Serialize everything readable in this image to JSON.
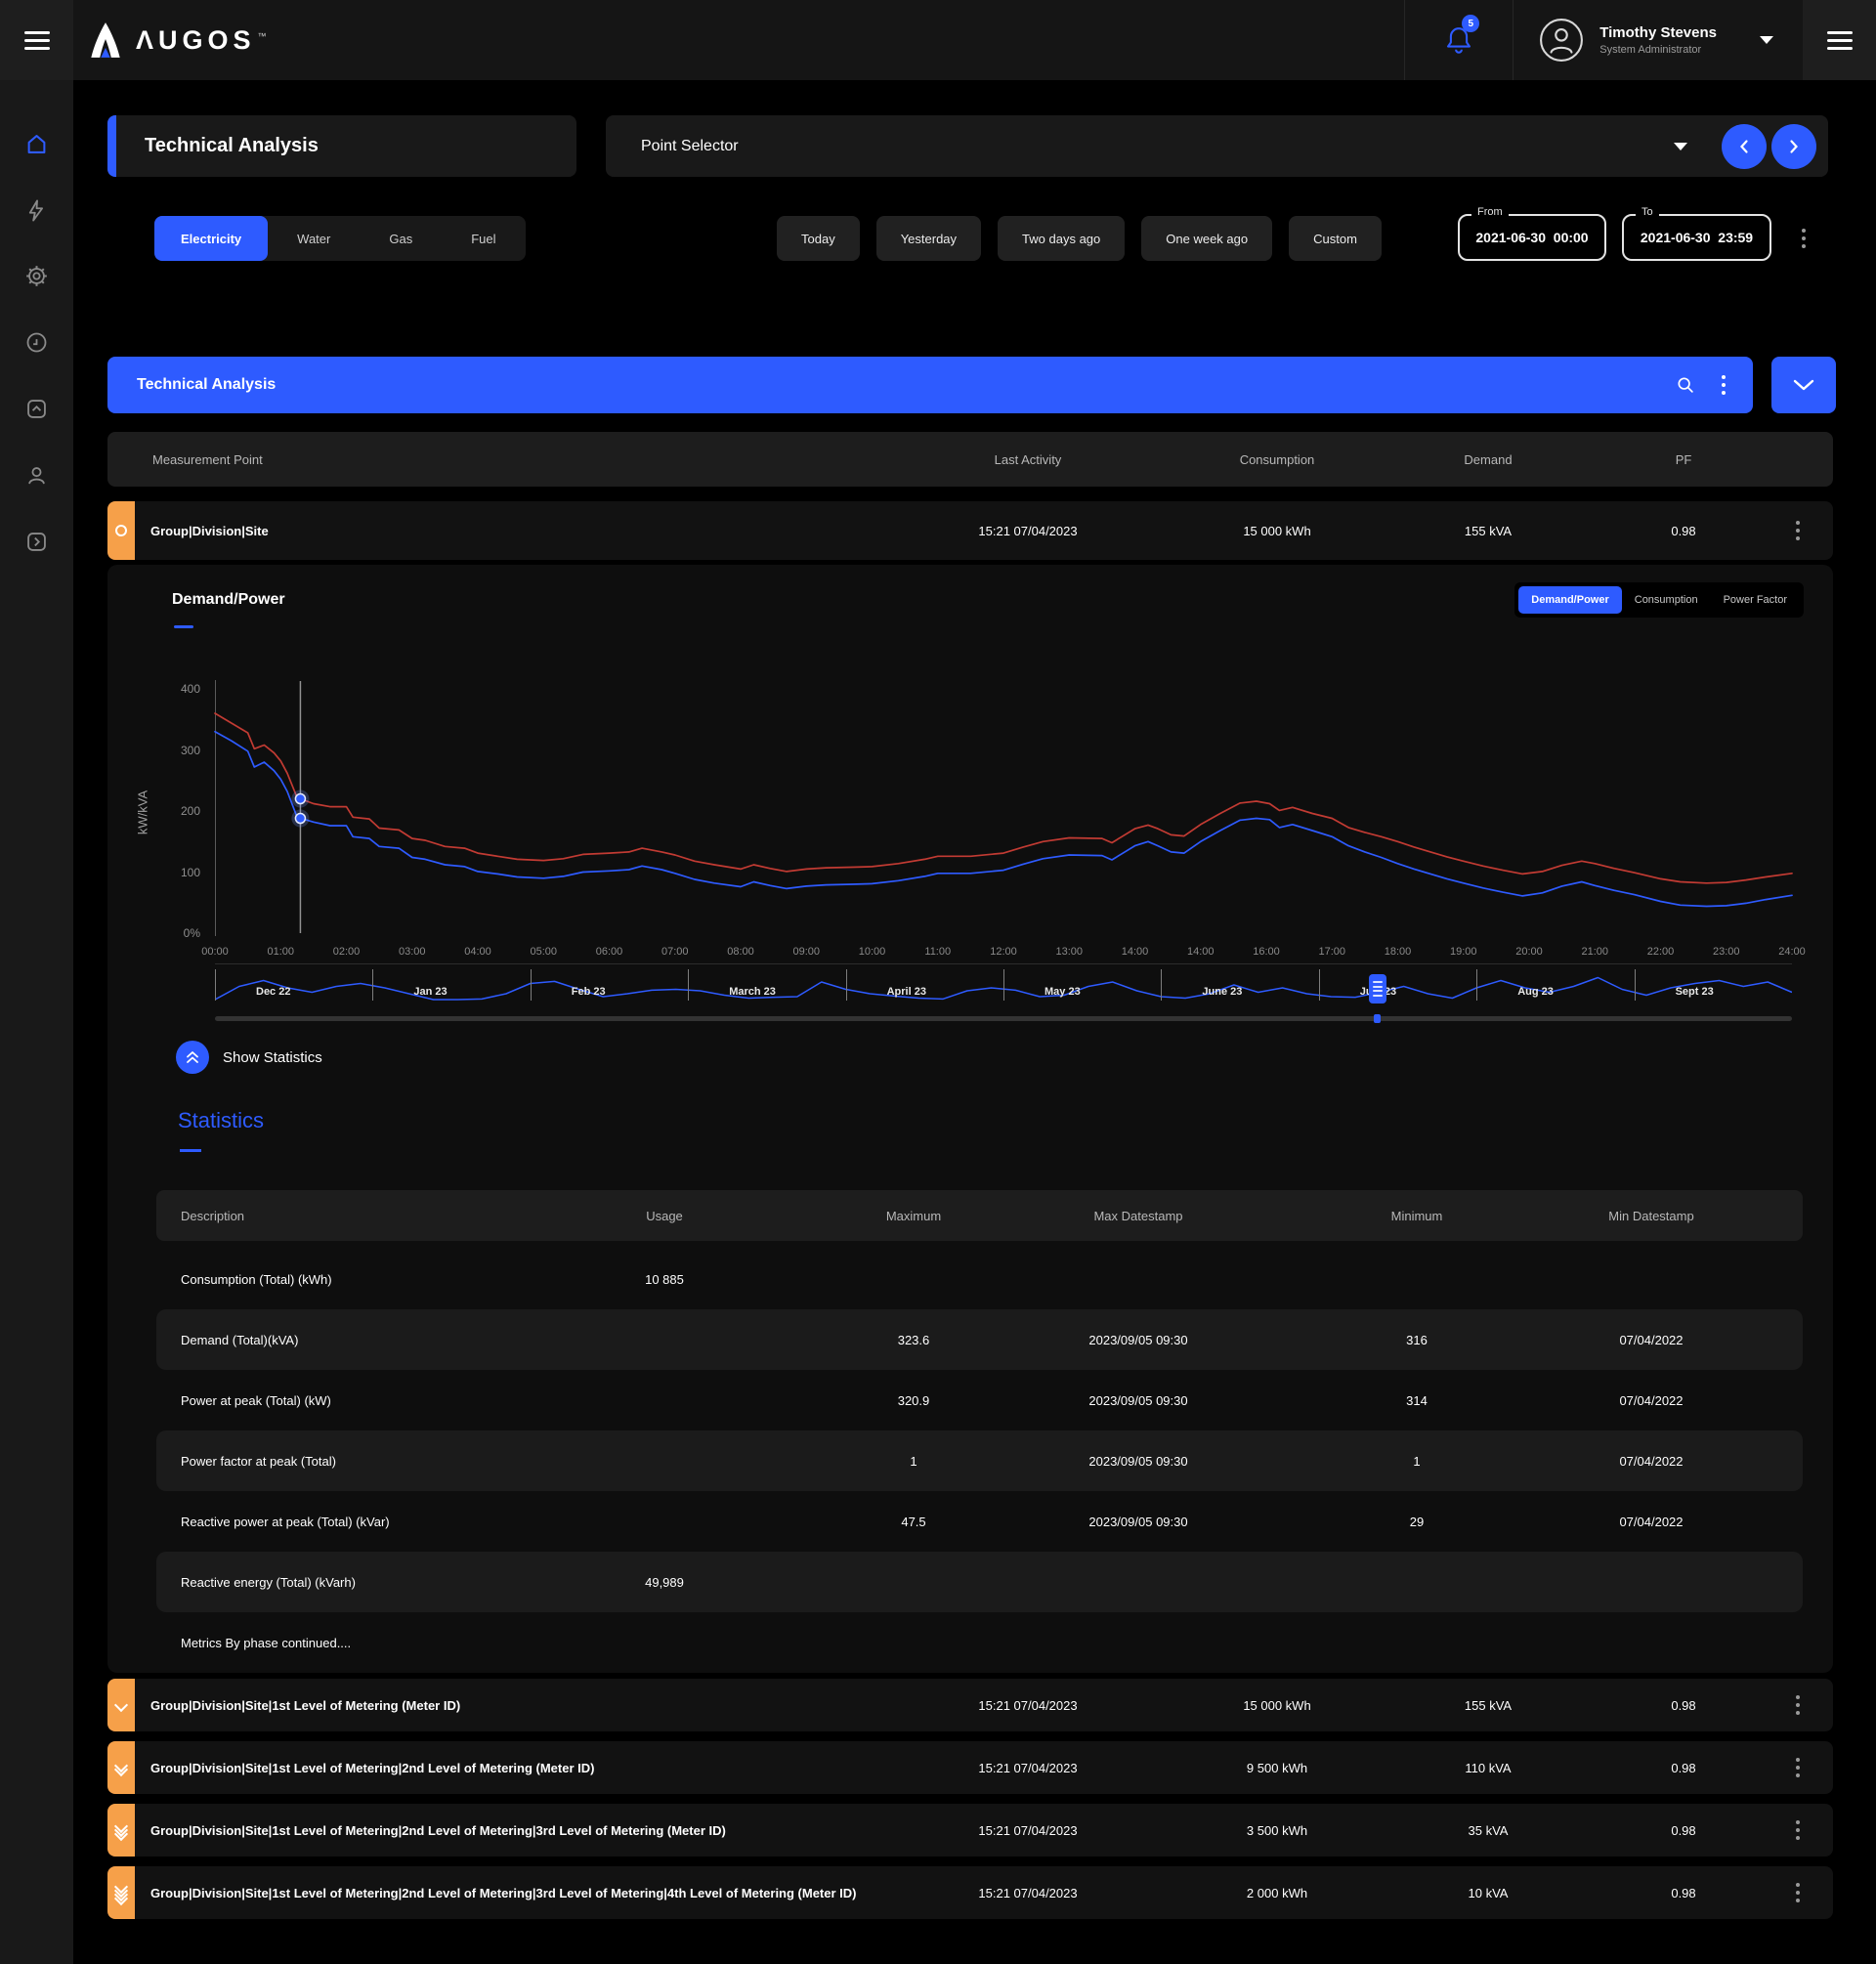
{
  "accent_blue": "#2E5BFF",
  "accent_orange": "#F6A049",
  "topbar": {
    "brand": "ΛUGOS",
    "brand_tm": "™",
    "notification_count": "5",
    "user_name": "Timothy Stevens",
    "user_role": "System Administrator"
  },
  "page": {
    "title": "Technical Analysis",
    "point_selector": "Point Selector"
  },
  "tabs": [
    {
      "label": "Electricity",
      "active": true
    },
    {
      "label": "Water",
      "active": false
    },
    {
      "label": "Gas",
      "active": false
    },
    {
      "label": "Fuel",
      "active": false
    }
  ],
  "time_filters": {
    "buttons": [
      "Today",
      "Yesterday",
      "Two days ago",
      "One week ago",
      "Custom"
    ],
    "from": {
      "label": "From",
      "value": "2021-06-30  00:00"
    },
    "to": {
      "label": "To",
      "value": "2021-06-30  23:59"
    }
  },
  "section_bar": {
    "title": "Technical Analysis"
  },
  "measurements": {
    "headers": [
      "Measurement Point",
      "Last Activity",
      "Consumption",
      "Demand",
      "PF"
    ],
    "main_row": {
      "name": "Group|Division|Site",
      "last_activity": "15:21 07/04/2023",
      "consumption": "15 000 kWh",
      "demand": "155 kVA",
      "pf": "0.98"
    },
    "child_rows": [
      {
        "level": 1,
        "name": "Group|Division|Site|1st Level of Metering (Meter ID)",
        "last_activity": "15:21 07/04/2023",
        "consumption": "15 000 kWh",
        "demand": "155 kVA",
        "pf": "0.98"
      },
      {
        "level": 2,
        "name": "Group|Division|Site|1st Level of Metering|2nd Level of Metering (Meter ID)",
        "last_activity": "15:21 07/04/2023",
        "consumption": "9 500 kWh",
        "demand": "110 kVA",
        "pf": "0.98"
      },
      {
        "level": 3,
        "name": "Group|Division|Site|1st Level of Metering|2nd Level of Metering|3rd Level of Metering (Meter ID)",
        "last_activity": "15:21 07/04/2023",
        "consumption": "3 500 kWh",
        "demand": "35 kVA",
        "pf": "0.98"
      },
      {
        "level": 4,
        "name": "Group|Division|Site|1st Level of Metering|2nd Level of Metering|3rd Level of Metering|4th Level of Metering (Meter ID)",
        "last_activity": "15:21 07/04/2023",
        "consumption": "2 000 kWh",
        "demand": "10 kVA",
        "pf": "0.98"
      }
    ]
  },
  "chart": {
    "title": "Demand/Power",
    "toggles": [
      {
        "label": "Demand/Power",
        "active": true
      },
      {
        "label": "Consumption",
        "active": false
      },
      {
        "label": "Power Factor",
        "active": false
      }
    ],
    "ylabel": "kW/kVA"
  },
  "chart_data": {
    "type": "line",
    "title": "Demand/Power",
    "ylabel": "kW/kVA",
    "ylim": [
      0,
      400
    ],
    "xlim_hours": [
      0,
      24
    ],
    "grid": false,
    "legend_position": "none",
    "y_ticks": [
      {
        "label": "400",
        "value": 400
      },
      {
        "label": "300",
        "value": 300
      },
      {
        "label": "200",
        "value": 200
      },
      {
        "label": "100",
        "value": 100
      },
      {
        "label": "0%",
        "value": 0
      }
    ],
    "x_tick_labels": [
      "00:00",
      "01:00",
      "02:00",
      "03:00",
      "04:00",
      "05:00",
      "06:00",
      "07:00",
      "08:00",
      "09:00",
      "10:00",
      "11:00",
      "12:00",
      "13:00",
      "14:00",
      "14:00",
      "16:00",
      "17:00",
      "18:00",
      "19:00",
      "20:00",
      "21:00",
      "22:00",
      "23:00",
      "24:00"
    ],
    "x_hours": [
      0,
      0.25,
      0.5,
      0.6,
      0.75,
      0.9,
      1,
      1.1,
      1.25,
      1.5,
      1.75,
      2,
      2.1,
      2.35,
      2.5,
      2.8,
      3,
      3.2,
      3.5,
      3.8,
      4,
      4.3,
      4.6,
      5,
      5.3,
      5.6,
      6,
      6.3,
      6.5,
      6.8,
      7,
      7.3,
      7.6,
      8,
      8.2,
      8.45,
      8.7,
      9,
      9.3,
      9.7,
      10,
      10.4,
      10.8,
      11,
      11.5,
      12,
      12.3,
      12.6,
      13,
      13.5,
      13.65,
      13.8,
      14,
      14.2,
      14.35,
      14.55,
      14.75,
      15,
      15.3,
      15.6,
      15.85,
      16.05,
      16.2,
      16.4,
      16.7,
      17,
      17.25,
      17.5,
      17.75,
      18,
      18.25,
      18.5,
      18.75,
      19,
      19.3,
      19.6,
      19.9,
      20.2,
      20.5,
      20.8,
      21,
      21.3,
      21.6,
      22,
      22.3,
      22.7,
      23,
      23.3,
      23.6,
      24
    ],
    "series": [
      {
        "name": "Demand (kVA)",
        "color": "#C23B33",
        "values": [
          360,
          344,
          328,
          302,
          308,
          295,
          282,
          262,
          222,
          212,
          207,
          207,
          190,
          187,
          172,
          169,
          155,
          152,
          142,
          139,
          131,
          126,
          121,
          119,
          122,
          129,
          131,
          133,
          139,
          133,
          128,
          118,
          112,
          105,
          112,
          106,
          101,
          105,
          107,
          108,
          109,
          114,
          121,
          126,
          126,
          131,
          141,
          150,
          156,
          155,
          148,
          158,
          171,
          177,
          171,
          161,
          159,
          178,
          196,
          213,
          216,
          212,
          201,
          206,
          196,
          188,
          173,
          165,
          158,
          150,
          141,
          133,
          125,
          118,
          110,
          103,
          97,
          101,
          111,
          118,
          114,
          106,
          99,
          89,
          84,
          82,
          83,
          87,
          92,
          98
        ]
      },
      {
        "name": "Power (kW)",
        "color": "#2E5BFF",
        "values": [
          330,
          315,
          298,
          272,
          280,
          266,
          252,
          232,
          190,
          182,
          176,
          176,
          158,
          155,
          142,
          139,
          124,
          121,
          112,
          109,
          101,
          97,
          92,
          90,
          93,
          100,
          102,
          104,
          110,
          104,
          98,
          88,
          82,
          76,
          84,
          78,
          73,
          77,
          79,
          80,
          81,
          86,
          93,
          98,
          98,
          103,
          113,
          122,
          128,
          127,
          120,
          130,
          143,
          150,
          143,
          133,
          131,
          150,
          168,
          185,
          188,
          186,
          173,
          178,
          168,
          158,
          143,
          133,
          124,
          114,
          105,
          97,
          89,
          82,
          74,
          67,
          61,
          66,
          77,
          84,
          78,
          70,
          63,
          52,
          46,
          44,
          45,
          49,
          55,
          62
        ]
      }
    ],
    "cursor": {
      "x_hour": 1.3,
      "demand": 220,
      "power": 188
    }
  },
  "timeline": {
    "months": [
      "Dec 22",
      "Jan 23",
      "Feb 23",
      "March 23",
      "April 23",
      "May 23",
      "June 23",
      "July 23",
      "Aug 23",
      "Sept 23"
    ],
    "handle_position": 0.737,
    "sparkline": [
      0.1,
      0.55,
      0.75,
      0.5,
      0.35,
      0.55,
      0.65,
      0.5,
      0.3,
      0.1,
      0.1,
      0.12,
      0.3,
      0.65,
      0.72,
      0.45,
      0.2,
      0.3,
      0.42,
      0.45,
      0.4,
      0.25,
      0.15,
      0.18,
      0.2,
      0.7,
      0.45,
      0.3,
      0.22,
      0.15,
      0.12,
      0.4,
      0.5,
      0.42,
      0.2,
      0.25,
      0.55,
      0.7,
      0.4,
      0.2,
      0.15,
      0.3,
      0.6,
      0.35,
      0.5,
      0.3,
      0.2,
      0.18,
      0.35,
      0.55,
      0.3,
      0.15,
      0.5,
      0.75,
      0.5,
      0.35,
      0.55,
      0.85,
      0.45,
      0.25,
      0.5,
      0.65,
      0.75,
      0.55,
      0.7,
      0.35
    ]
  },
  "show_statistics": "Show Statistics",
  "statistics": {
    "heading": "Statistics",
    "headers": [
      "Description",
      "Usage",
      "Maximum",
      "Max Datestamp",
      "Minimum",
      "Min Datestamp"
    ],
    "rows": [
      {
        "description": "Consumption (Total) (kWh)",
        "usage": "10 885",
        "maximum": "",
        "max_datestamp": "",
        "minimum": "",
        "min_datestamp": ""
      },
      {
        "description": "Demand (Total)(kVA)",
        "usage": "",
        "maximum": "323.6",
        "max_datestamp": "2023/09/05 09:30",
        "minimum": "316",
        "min_datestamp": "07/04/2022"
      },
      {
        "description": "Power at peak (Total) (kW)",
        "usage": "",
        "maximum": "320.9",
        "max_datestamp": "2023/09/05 09:30",
        "minimum": "314",
        "min_datestamp": "07/04/2022"
      },
      {
        "description": "Power factor at peak (Total)",
        "usage": "",
        "maximum": "1",
        "max_datestamp": "2023/09/05 09:30",
        "minimum": "1",
        "min_datestamp": "07/04/2022"
      },
      {
        "description": "Reactive power at peak (Total) (kVar)",
        "usage": "",
        "maximum": "47.5",
        "max_datestamp": "2023/09/05 09:30",
        "minimum": "29",
        "min_datestamp": "07/04/2022"
      },
      {
        "description": "Reactive energy (Total) (kVarh)",
        "usage": "49,989",
        "maximum": "",
        "max_datestamp": "",
        "minimum": "",
        "min_datestamp": ""
      }
    ],
    "footnote": "Metrics By phase continued...."
  },
  "icons": [
    "hamburger-menu-icon",
    "bell-icon",
    "avatar-icon",
    "caret-down-icon",
    "home-icon",
    "lightning-icon",
    "gear-icon",
    "clock-icon",
    "collapse-up-icon",
    "user-icon",
    "expand-right-icon",
    "chevron-left-icon",
    "chevron-right-icon",
    "search-icon",
    "kebab-menu-icon",
    "chevron-down-icon",
    "circle-marker-icon",
    "chevron-level-icon",
    "double-chevron-up-icon",
    "drag-handle-icon",
    "logo-mark-icon"
  ]
}
